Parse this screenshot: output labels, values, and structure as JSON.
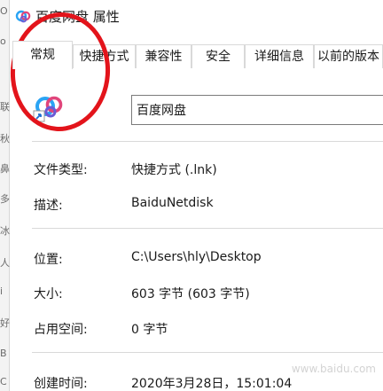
{
  "window": {
    "title": "百度网盘 属性"
  },
  "tabs": [
    {
      "label": "常规",
      "active": true
    },
    {
      "label": "快捷方式"
    },
    {
      "label": "兼容性"
    },
    {
      "label": "安全"
    },
    {
      "label": "详细信息"
    },
    {
      "label": "以前的版本"
    }
  ],
  "general": {
    "name": "百度网盘",
    "rows": [
      {
        "label": "文件类型:",
        "value": "快捷方式 (.lnk)"
      },
      {
        "label": "描述:",
        "value": "BaiduNetdisk"
      },
      {
        "label": "位置:",
        "value": "C:\\Users\\hly\\Desktop"
      },
      {
        "label": "大小:",
        "value": "603 字节 (603 字节)"
      },
      {
        "label": "占用空间:",
        "value": "0 字节"
      },
      {
        "label": "创建时间:",
        "value": "2020年3月28日，15:01:04"
      }
    ]
  },
  "background_window_glyphs": [
    "O",
    "o",
    "联",
    "秋",
    "鼻",
    "多",
    "冰",
    "人",
    "i",
    "好",
    "B",
    "C"
  ],
  "annotation": {
    "color": "#e3141b"
  },
  "watermark": "www.baidu.com"
}
